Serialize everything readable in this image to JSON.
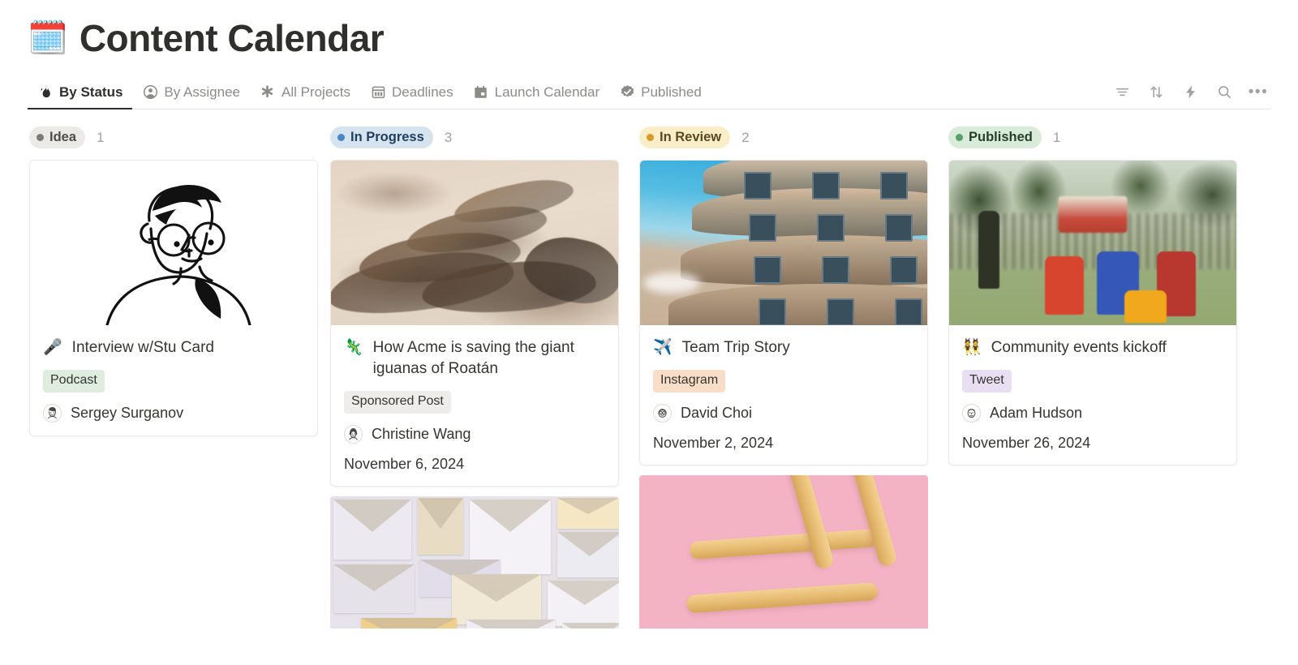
{
  "header": {
    "emoji": "🗓️",
    "emoji_name": "spiral-calendar",
    "title": "Content Calendar"
  },
  "tabs": [
    {
      "label": "By Status",
      "icon": "fire-icon",
      "active": true
    },
    {
      "label": "By Assignee",
      "icon": "person-circle-icon",
      "active": false
    },
    {
      "label": "All Projects",
      "icon": "asterisk-icon",
      "active": false
    },
    {
      "label": "Deadlines",
      "icon": "calendar-grid-icon",
      "active": false
    },
    {
      "label": "Launch Calendar",
      "icon": "calendar-icon",
      "active": false
    },
    {
      "label": "Published",
      "icon": "verified-check-icon",
      "active": false
    }
  ],
  "toolbar": [
    {
      "name": "filter-icon",
      "title": "Filter"
    },
    {
      "name": "sort-icon",
      "title": "Sort"
    },
    {
      "name": "lightning-icon",
      "title": "Automations"
    },
    {
      "name": "search-icon",
      "title": "Search"
    },
    {
      "name": "more-icon",
      "title": "More",
      "glyph": "•••"
    }
  ],
  "board": {
    "columns": [
      {
        "status": "Idea",
        "count": "1",
        "pill_bg": "#eceae7",
        "pill_text": "#4f4d47",
        "dot_color": "#7e7c76",
        "cards": [
          {
            "cover": "line-art-portrait",
            "emoji": "🎤",
            "emoji_name": "microphone",
            "title": "Interview w/Stu Card",
            "tag": "Podcast",
            "tag_bg": "#dfeddf",
            "person": "Sergey Surganov",
            "date": "",
            "framed": true
          }
        ]
      },
      {
        "status": "In Progress",
        "count": "3",
        "pill_bg": "#d6e4f0",
        "pill_text": "#1f3f5c",
        "dot_color": "#4a86c7",
        "cards": [
          {
            "cover": "iguanas",
            "emoji": "🦎",
            "emoji_name": "lizard",
            "title": "How Acme is saving the giant iguanas of Roatán",
            "tag": "Sponsored Post",
            "tag_bg": "#eeedeb",
            "person": "Christine Wang",
            "date": "November 6, 2024",
            "framed": true
          },
          {
            "cover": "envelopes",
            "emoji": "",
            "emoji_name": "",
            "title": "",
            "tag": "",
            "tag_bg": "",
            "person": "",
            "date": "",
            "framed": false
          }
        ]
      },
      {
        "status": "In Review",
        "count": "2",
        "pill_bg": "#faeec9",
        "pill_text": "#5b4720",
        "dot_color": "#d99b28",
        "cards": [
          {
            "cover": "gaudi-building",
            "emoji": "✈️",
            "emoji_name": "airplane",
            "title": "Team Trip Story",
            "tag": "Instagram",
            "tag_bg": "#f8ddc8",
            "person": "David Choi",
            "date": "November 2, 2024",
            "framed": true
          },
          {
            "cover": "hashtag-breadsticks",
            "emoji": "",
            "emoji_name": "",
            "title": "",
            "tag": "",
            "tag_bg": "",
            "person": "",
            "date": "",
            "framed": false
          }
        ]
      },
      {
        "status": "Published",
        "count": "1",
        "pill_bg": "#d9ecd9",
        "pill_text": "#26402a",
        "dot_color": "#5a9e6a",
        "cards": [
          {
            "cover": "festival-crowd",
            "emoji": "👯",
            "emoji_name": "people-with-bunny-ears",
            "title": "Community events kickoff",
            "tag": "Tweet",
            "tag_bg": "#e8dff2",
            "person": "Adam Hudson",
            "date": "November 26, 2024",
            "framed": true
          }
        ]
      }
    ]
  }
}
